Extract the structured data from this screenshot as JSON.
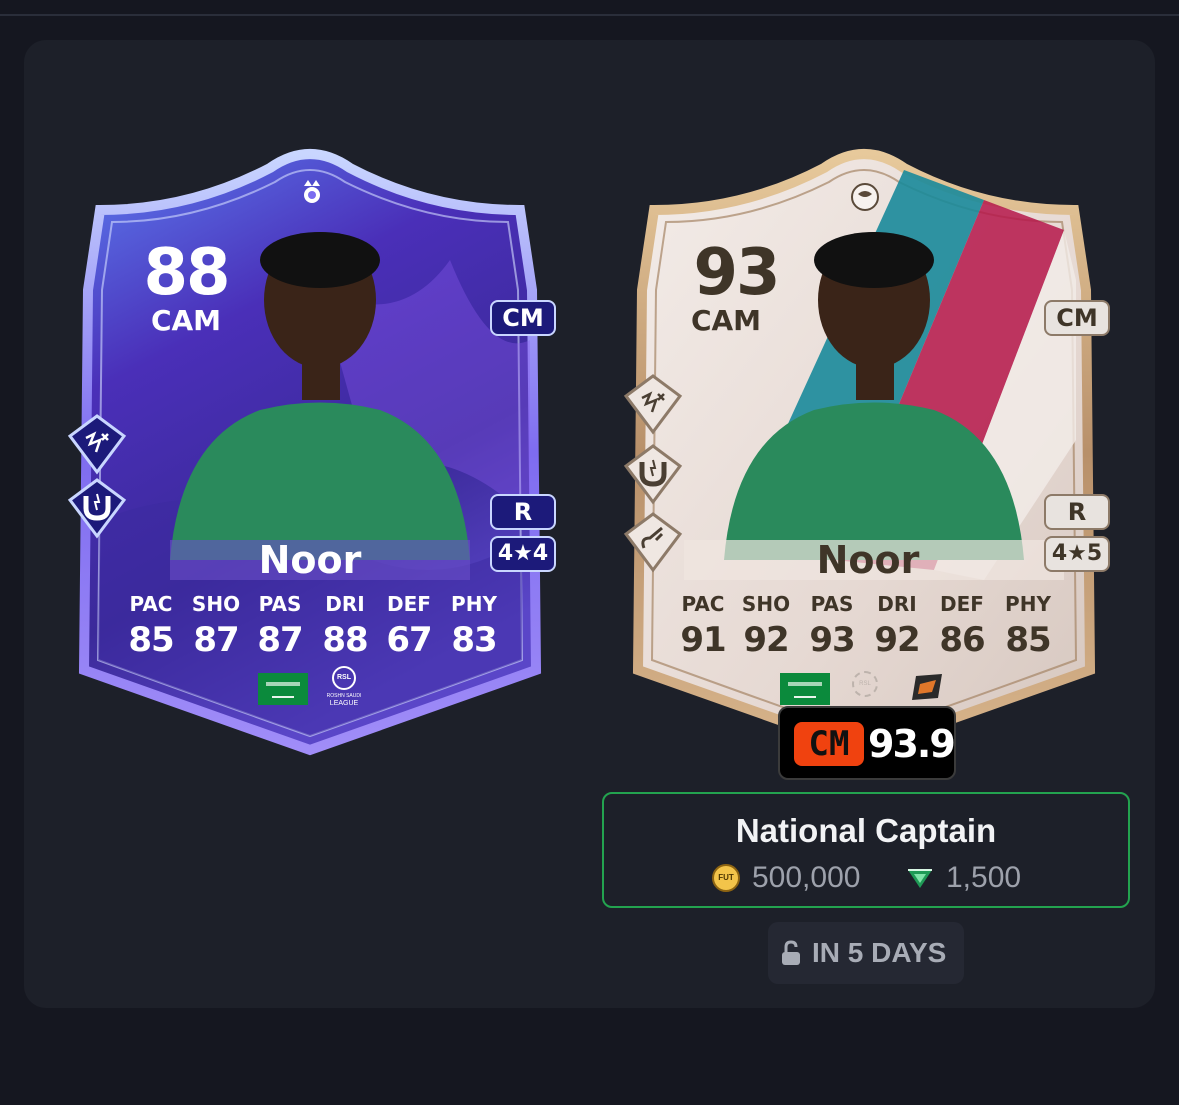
{
  "cards": [
    {
      "rating": "88",
      "position": "CAM",
      "alt_position": "CM",
      "foot": "R",
      "skill_weak": "4★4",
      "name": "Noor",
      "stats": [
        {
          "label": "PAC",
          "value": "85"
        },
        {
          "label": "SHO",
          "value": "87"
        },
        {
          "label": "PAS",
          "value": "87"
        },
        {
          "label": "DRI",
          "value": "88"
        },
        {
          "label": "DEF",
          "value": "67"
        },
        {
          "label": "PHY",
          "value": "83"
        }
      ],
      "league_logo_text": [
        "RSL",
        "ROSHN SAUDI",
        "LEAGUE"
      ],
      "colors": {
        "frame": "#8a7cf0",
        "bg_top": "#3a2f9e",
        "bg_bottom": "#2a2478",
        "text": "#ffffff",
        "pill_bg": "#1c1a7a"
      },
      "icons": [
        "crown-icon",
        "playstyle-pass-icon",
        "playstyle-magnet-icon",
        "saudi-flag-icon",
        "league-logo-icon"
      ]
    },
    {
      "rating": "93",
      "position": "CAM",
      "alt_position": "CM",
      "foot": "R",
      "skill_weak": "4★5",
      "name": "Noor",
      "stats": [
        {
          "label": "PAC",
          "value": "91"
        },
        {
          "label": "SHO",
          "value": "92"
        },
        {
          "label": "PAS",
          "value": "93"
        },
        {
          "label": "DRI",
          "value": "92"
        },
        {
          "label": "DEF",
          "value": "86"
        },
        {
          "label": "PHY",
          "value": "85"
        }
      ],
      "league_logo_text": [
        "RSL"
      ],
      "colors": {
        "frame": "#c9a57a",
        "bg_top": "#efe3de",
        "bg_bottom": "#d9cbc4",
        "text": "#3f3528",
        "pill_bg": "#e8e3df"
      },
      "icons": [
        "world-ball-icon",
        "playstyle-pass-icon",
        "playstyle-magnet-icon",
        "playstyle-hook-icon",
        "saudi-flag-icon",
        "club-badge-icon"
      ]
    }
  ],
  "rating_tag": {
    "position": "CM",
    "value": "93.9",
    "color": "#f0420f"
  },
  "objective": {
    "title": "National Captain",
    "coins": "500,000",
    "coin_icon_text": "FUT",
    "points": "1,500",
    "border_color": "#23a34f"
  },
  "unlock": {
    "label": "IN 5 DAYS",
    "icon": "lock-open-icon"
  }
}
